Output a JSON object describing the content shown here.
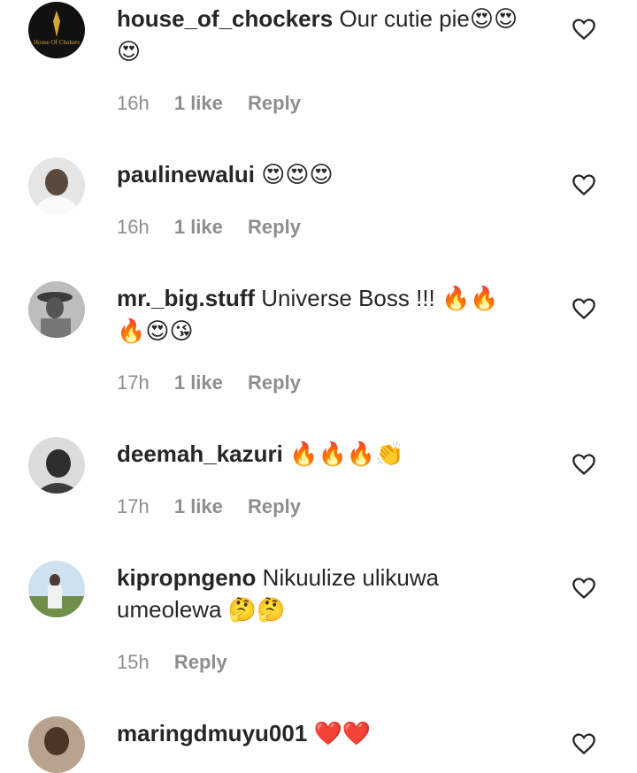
{
  "comments": [
    {
      "username": "house_of_chockers",
      "text": "Our cutie pie",
      "emojis_inline": "😍😍",
      "emojis_line2": "😍",
      "time": "16h",
      "likes": "1 like",
      "reply": "Reply",
      "avatar_label": "House Of Chokers"
    },
    {
      "username": "paulinewalui",
      "text": "",
      "emojis_inline": "😍😍😍",
      "time": "16h",
      "likes": "1 like",
      "reply": "Reply"
    },
    {
      "username": "mr._big.stuff",
      "text": "Universe Boss !!!",
      "emojis_inline": "🔥🔥",
      "emojis_line2": "🔥😍😘",
      "time": "17h",
      "likes": "1 like",
      "reply": "Reply"
    },
    {
      "username": "deemah_kazuri",
      "text": "",
      "emojis_inline": "🔥🔥🔥👏",
      "time": "17h",
      "likes": "1 like",
      "reply": "Reply"
    },
    {
      "username": "kipropngeno",
      "text": "Nikuulize ulikuwa",
      "line2_text": "umeolewa",
      "emojis_line2": "🤔🤔",
      "time": "15h",
      "reply": "Reply"
    },
    {
      "username": "maringdmuyu001",
      "text": "",
      "emojis_inline": "❤️❤️"
    }
  ],
  "icons": {
    "like": "heart-outline-icon"
  },
  "colors": {
    "text": "#262626",
    "meta": "#8e8e8e"
  }
}
